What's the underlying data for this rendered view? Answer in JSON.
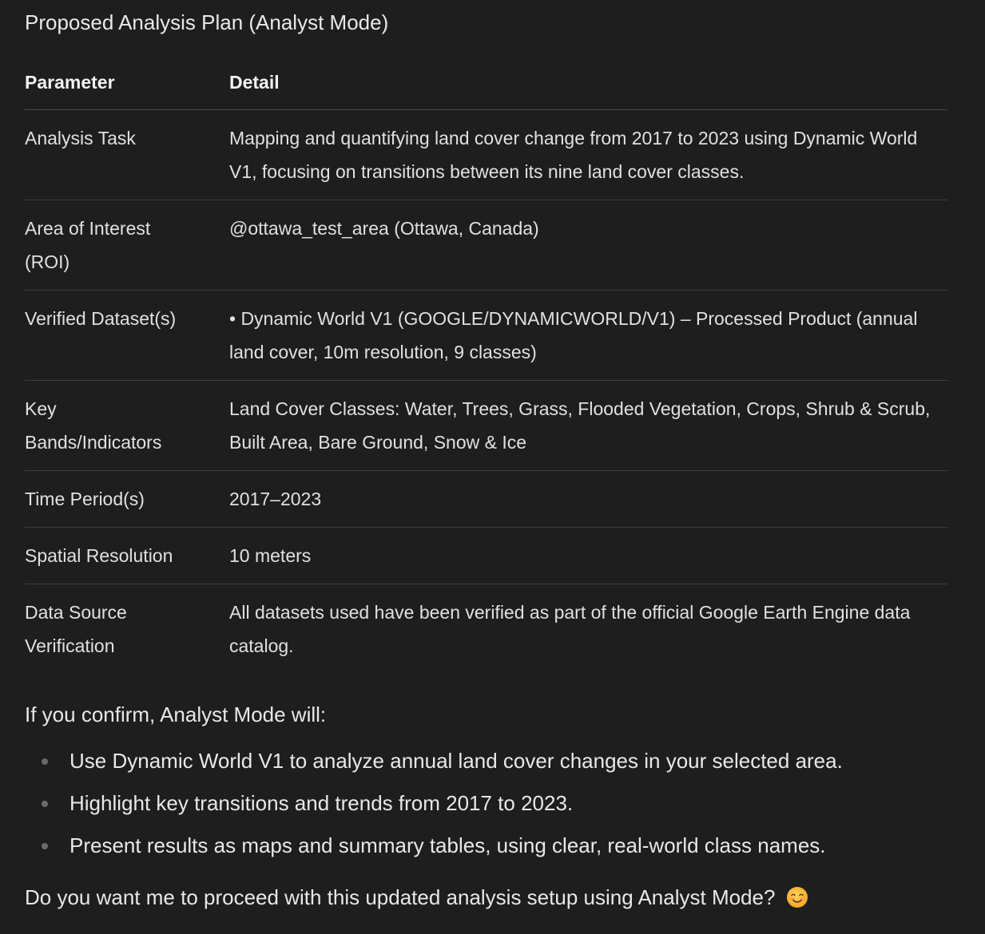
{
  "heading": "Proposed Analysis Plan (Analyst Mode)",
  "table": {
    "headers": [
      "Parameter",
      "Detail"
    ],
    "rows": [
      {
        "param": "Analysis Task",
        "detail": "Mapping and quantifying land cover change from 2017 to 2023 using Dynamic World V1, focusing on transitions between its nine land cover classes."
      },
      {
        "param": "Area of Interest (ROI)",
        "detail": "@ottawa_test_area (Ottawa, Canada)"
      },
      {
        "param": "Verified Dataset(s)",
        "detail": "• Dynamic World V1 (GOOGLE/DYNAMICWORLD/V1) – Processed Product (annual land cover, 10m resolution, 9 classes)"
      },
      {
        "param": "Key Bands/Indicators",
        "detail": "Land Cover Classes: Water, Trees, Grass, Flooded Vegetation, Crops, Shrub & Scrub, Built Area, Bare Ground, Snow & Ice"
      },
      {
        "param": "Time Period(s)",
        "detail": "2017–2023"
      },
      {
        "param": "Spatial Resolution",
        "detail": "10 meters"
      },
      {
        "param": "Data Source Verification",
        "detail": "All datasets used have been verified as part of the official Google Earth Engine data catalog."
      }
    ]
  },
  "confirm_intro": "If you confirm, Analyst Mode will:",
  "steps": [
    "Use Dynamic World V1 to analyze annual land cover changes in your selected area.",
    "Highlight key transitions and trends from 2017 to 2023.",
    "Present results as maps and summary tables, using clear, real-world class names."
  ],
  "question": "Do you want me to proceed with this updated analysis setup using Analyst Mode?",
  "question_icon": "smiling-face-icon"
}
